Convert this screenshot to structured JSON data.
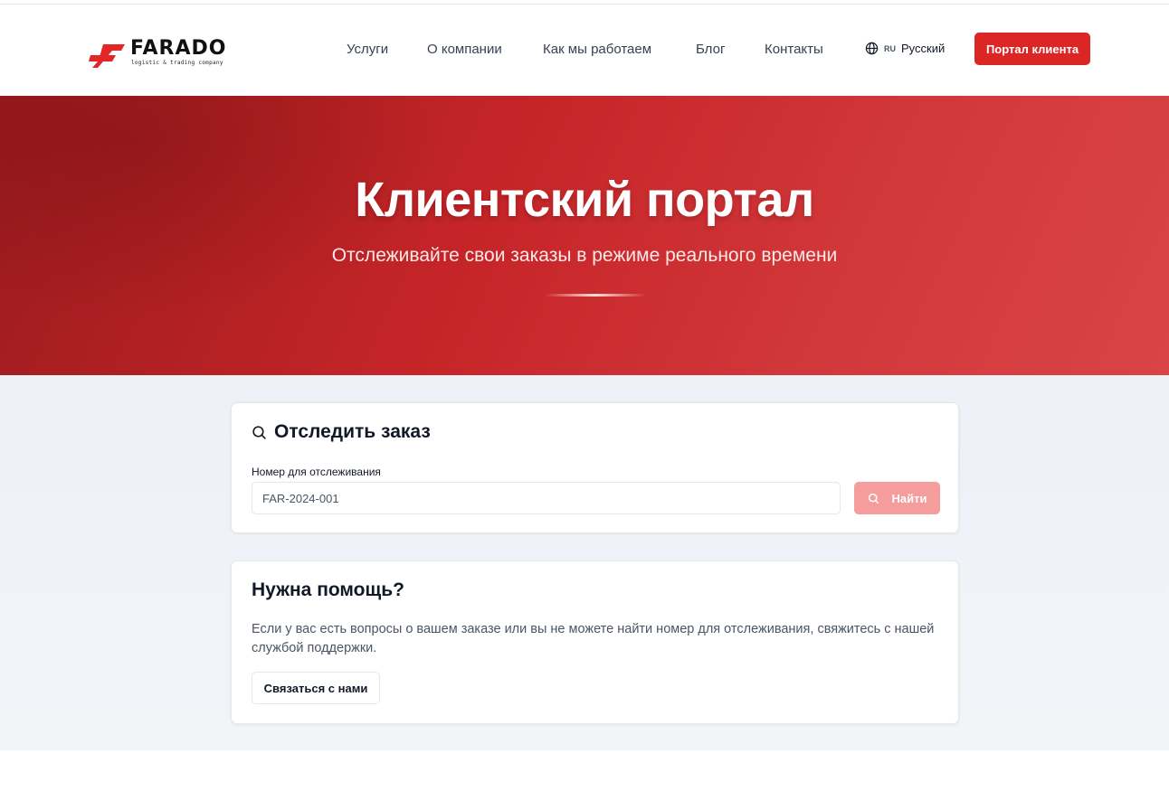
{
  "header": {
    "logo_text": "FARADO",
    "logo_tagline": "logistic & trading company",
    "nav": [
      {
        "label": "Услуги"
      },
      {
        "label": "О компании"
      },
      {
        "label": "Как мы работаем"
      },
      {
        "label": "Блог"
      },
      {
        "label": "Контакты"
      }
    ],
    "language": {
      "code": "RU",
      "label": "Русский",
      "icon": "globe-icon"
    },
    "portal_button": "Портал клиента"
  },
  "hero": {
    "title": "Клиентский портал",
    "subtitle": "Отслеживайте свои заказы в режиме реального времени"
  },
  "tracking": {
    "title": "Отследить заказ",
    "title_icon": "search-icon",
    "field_label": "Номер для отслеживания",
    "placeholder": "FAR-2024-001",
    "value": "",
    "search_button": "Найти",
    "search_button_icon": "search-icon"
  },
  "help": {
    "title": "Нужна помощь?",
    "text": "Если у вас есть вопросы о вашем заказе или вы не можете найти номер для отслеживания, свяжитесь с нашей службой поддержки.",
    "contact_button": "Связаться с нами"
  },
  "colors": {
    "brand_red": "#dc2626",
    "hero_dark": "#9b1b1e",
    "hero_light": "#d94446",
    "disabled_button": "#f59c9c",
    "content_bg": "#edf1f7"
  }
}
